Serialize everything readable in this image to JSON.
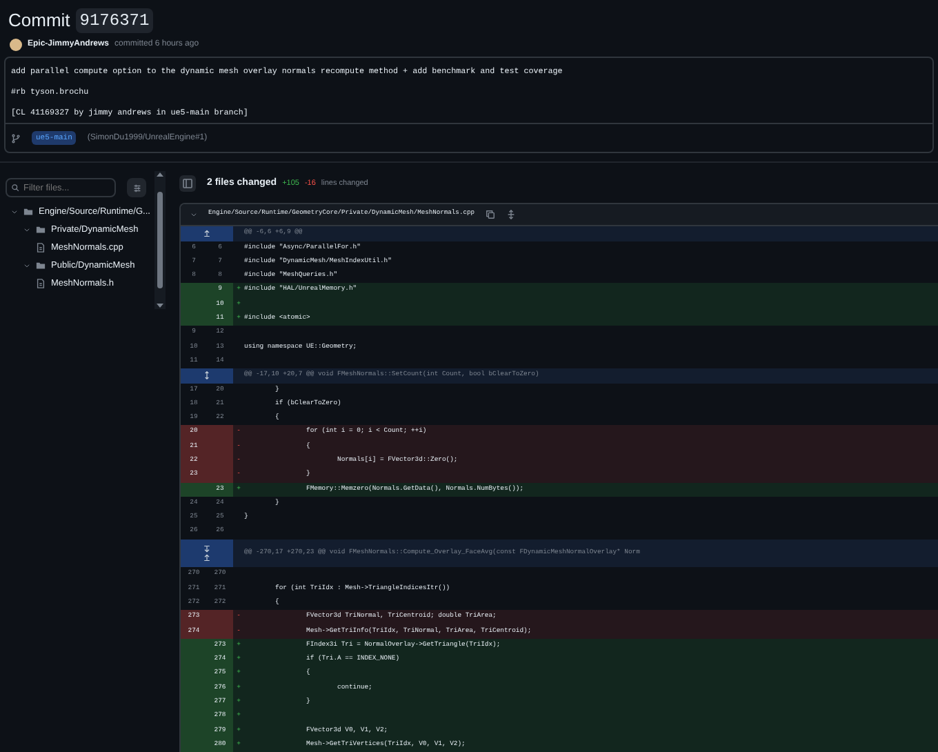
{
  "commit": {
    "title": "Commit",
    "sha": "9176371"
  },
  "author": {
    "name": "Epic-JimmyAndrews",
    "action": "committed 6 hours ago"
  },
  "message": [
    "add parallel compute option to the dynamic mesh overlay normals recompute method + add benchmark and test coverage",
    "#rb tyson.brochu",
    "[CL 41169327 by jimmy andrews in ue5-main branch]"
  ],
  "branch": {
    "name": "ue5-main",
    "ref": "(SimonDu1999/UnrealEngine#1)"
  },
  "sidebar": {
    "filter": {
      "placeholder": "Filter files..."
    },
    "tree": [
      {
        "label": "Engine/Source/Runtime/G...",
        "kind": "folder",
        "expanded": true,
        "children": [
          {
            "label": "Private/DynamicMesh",
            "kind": "folder",
            "expanded": true,
            "children": [
              {
                "label": "MeshNormals.cpp",
                "kind": "file"
              }
            ]
          },
          {
            "label": "Public/DynamicMesh",
            "kind": "folder",
            "expanded": true,
            "children": [
              {
                "label": "MeshNormals.h",
                "kind": "file"
              }
            ]
          }
        ]
      }
    ]
  },
  "summary": {
    "files_changed": "2 files changed",
    "additions": "+105",
    "deletions": "-16",
    "suffix": "lines changed"
  },
  "file": {
    "path": "Engine/Source/Runtime/GeometryCore/Private/DynamicMesh/MeshNormals.cpp",
    "expanded": true,
    "rows": [
      {
        "kind": "hunk",
        "expand_up": true,
        "expand_down": false,
        "text": "@@ -6,6 +6,9 @@"
      },
      {
        "kind": "context",
        "old": "6",
        "new": "6",
        "code": "#include \"Async/ParallelFor.h\""
      },
      {
        "kind": "context",
        "old": "7",
        "new": "7",
        "code": "#include \"DynamicMesh/MeshIndexUtil.h\""
      },
      {
        "kind": "context",
        "old": "8",
        "new": "8",
        "code": "#include \"MeshQueries.h\""
      },
      {
        "kind": "add",
        "new": "9",
        "sign": "+",
        "code": "#include \"HAL/UnrealMemory.h\""
      },
      {
        "kind": "add",
        "new": "10",
        "sign": "+"
      },
      {
        "kind": "add",
        "new": "11",
        "sign": "+",
        "code": "#include <atomic>"
      },
      {
        "kind": "context",
        "old": "9",
        "new": "12"
      },
      {
        "kind": "context",
        "old": "10",
        "new": "13",
        "code": "using namespace UE::Geometry;"
      },
      {
        "kind": "context",
        "old": "11",
        "new": "14"
      },
      {
        "kind": "hunk",
        "expand_up": true,
        "expand_down": true,
        "combined": true,
        "text": "@@ -17,10 +20,7 @@ void FMeshNormals::SetCount(int Count, bool bClearToZero)"
      },
      {
        "kind": "context",
        "old": "17",
        "new": "20",
        "code": "        }"
      },
      {
        "kind": "context",
        "old": "18",
        "new": "21",
        "code": "        if (bClearToZero)"
      },
      {
        "kind": "context",
        "old": "19",
        "new": "22",
        "code": "        {"
      },
      {
        "kind": "del",
        "old": "20",
        "sign": "-",
        "code": "                for (int i = 0; i < Count; ++i)"
      },
      {
        "kind": "del",
        "old": "21",
        "sign": "-",
        "code": "                {"
      },
      {
        "kind": "del",
        "old": "22",
        "sign": "-",
        "code": "                        Normals[i] = FVector3d::Zero();"
      },
      {
        "kind": "del",
        "old": "23",
        "sign": "-",
        "code": "                }"
      },
      {
        "kind": "add",
        "new": "23",
        "sign": "+",
        "code": "                FMemory::Memzero(Normals.GetData(), Normals.NumBytes());"
      },
      {
        "kind": "context",
        "old": "24",
        "new": "24",
        "code": "        }"
      },
      {
        "kind": "context",
        "old": "25",
        "new": "25",
        "code": "}"
      },
      {
        "kind": "context",
        "old": "26",
        "new": "26"
      },
      {
        "kind": "hunk",
        "expand_up": true,
        "expand_down": true,
        "combined": false,
        "text": "@@ -270,17 +270,23 @@ void FMeshNormals::Compute_Overlay_FaceAvg(const FDynamicMeshNormalOverlay* Norm"
      },
      {
        "kind": "context",
        "old": "270",
        "new": "270"
      },
      {
        "kind": "context",
        "old": "271",
        "new": "271",
        "code": "        for (int TriIdx : Mesh->TriangleIndicesItr())"
      },
      {
        "kind": "context",
        "old": "272",
        "new": "272",
        "code": "        {"
      },
      {
        "kind": "del",
        "old": "273",
        "sign": "-",
        "code": "                FVector3d TriNormal, TriCentroid; double TriArea;"
      },
      {
        "kind": "del",
        "old": "274",
        "sign": "-",
        "code": "                Mesh->GetTriInfo(TriIdx, TriNormal, TriArea, TriCentroid);"
      },
      {
        "kind": "add",
        "new": "273",
        "sign": "+",
        "code": "                FIndex3i Tri = NormalOverlay->GetTriangle(TriIdx);"
      },
      {
        "kind": "add",
        "new": "274",
        "sign": "+",
        "code": "                if (Tri.A == INDEX_NONE)"
      },
      {
        "kind": "add",
        "new": "275",
        "sign": "+",
        "code": "                {"
      },
      {
        "kind": "add",
        "new": "276",
        "sign": "+",
        "code": "                        continue;"
      },
      {
        "kind": "add",
        "new": "277",
        "sign": "+",
        "code": "                }"
      },
      {
        "kind": "add",
        "new": "278",
        "sign": "+"
      },
      {
        "kind": "add",
        "new": "279",
        "sign": "+",
        "code": "                FVector3d V0, V1, V2;"
      },
      {
        "kind": "add",
        "new": "280",
        "sign": "+",
        "code": "                Mesh->GetTriVertices(TriIdx, V0, V1, V2);"
      }
    ]
  }
}
